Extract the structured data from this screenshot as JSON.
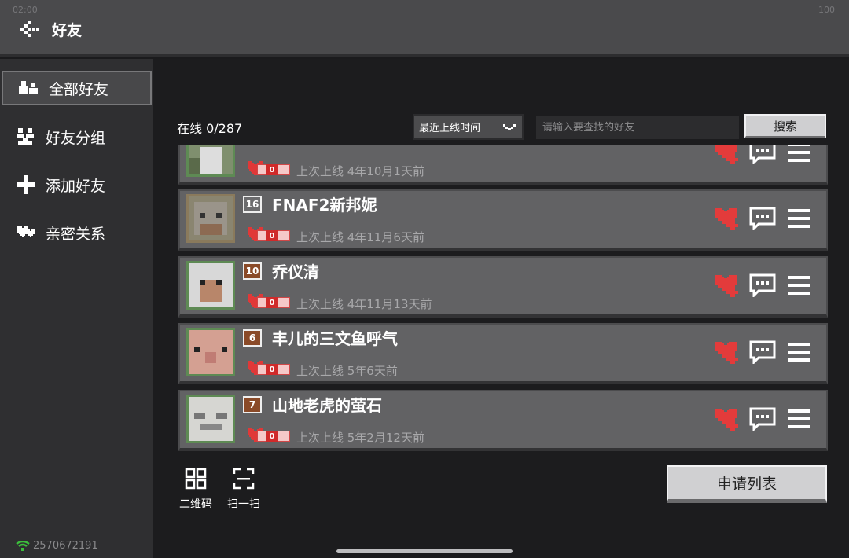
{
  "status": {
    "time": "02:00",
    "battery": "100"
  },
  "header": {
    "title": "好友",
    "back_icon": "back-arrow-icon"
  },
  "sidebar": {
    "items": [
      {
        "label": "全部好友",
        "icon": "people-icon",
        "active": true
      },
      {
        "label": "好友分组",
        "icon": "group-icon",
        "active": false
      },
      {
        "label": "添加好友",
        "icon": "plus-icon",
        "active": false
      },
      {
        "label": "亲密关系",
        "icon": "hearts-icon",
        "active": false
      }
    ],
    "uid": "2570672191"
  },
  "toolbar": {
    "online": "在线 0/287",
    "sort_value": "最近上线时间",
    "search_placeholder": "请输入要查找的好友",
    "search_label": "搜索"
  },
  "friends": [
    {
      "name": "",
      "level": "",
      "intimacy": "0",
      "last_online": "上次上线 4年10月1天前"
    },
    {
      "name": "FNAF2新邦妮",
      "level": "16",
      "intimacy": "0",
      "last_online": "上次上线 4年11月6天前"
    },
    {
      "name": "乔仪清",
      "level": "10",
      "intimacy": "0",
      "last_online": "上次上线 4年11月13天前"
    },
    {
      "name": "丰儿的三文鱼呼气",
      "level": "6",
      "intimacy": "0",
      "last_online": "上次上线 5年6天前"
    },
    {
      "name": "山地老虎的萤石",
      "level": "7",
      "intimacy": "0",
      "last_online": "上次上线 5年2月12天前"
    }
  ],
  "bottom": {
    "qr_label": "二维码",
    "scan_label": "扫一扫",
    "apply_label": "申请列表"
  },
  "colors": {
    "accent_heart": "#d93a3a",
    "level_badge": "#8a4a28"
  }
}
